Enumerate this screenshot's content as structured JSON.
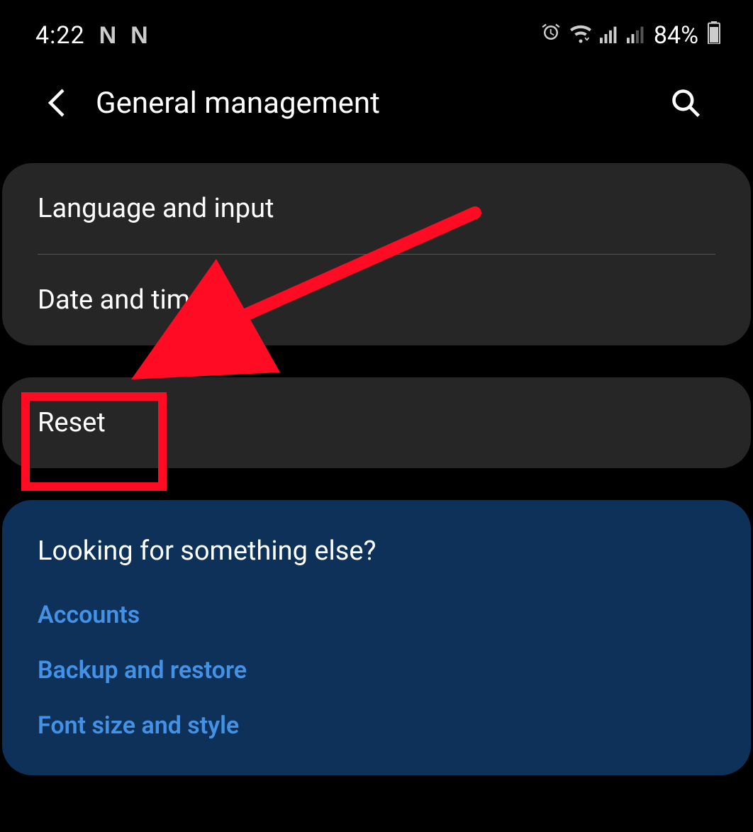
{
  "statusBar": {
    "time": "4:22",
    "appIcon1": "N",
    "appIcon2": "N",
    "batteryPercent": "84%"
  },
  "header": {
    "title": "General management"
  },
  "settings": {
    "group1": {
      "item1": "Language and input",
      "item2": "Date and time"
    },
    "group2": {
      "item1": "Reset"
    }
  },
  "suggestions": {
    "title": "Looking for something else?",
    "links": {
      "link1": "Accounts",
      "link2": "Backup and restore",
      "link3": "Font size and style"
    }
  }
}
